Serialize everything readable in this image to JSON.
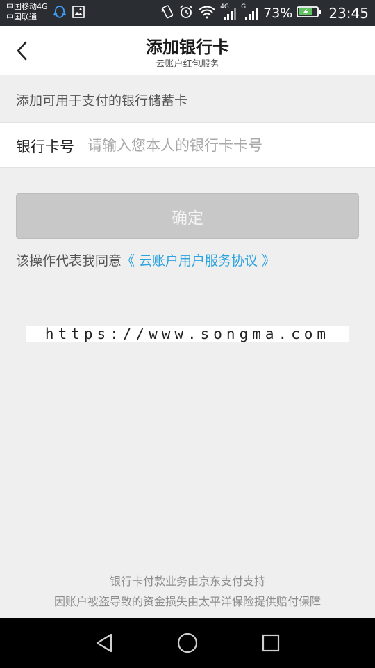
{
  "status_bar": {
    "carrier_1": "中国移动4G",
    "carrier_2": "中国联通",
    "network_1": "4G",
    "network_2": "G",
    "battery": "73%",
    "time": "23:45"
  },
  "header": {
    "title": "添加银行卡",
    "subtitle": "云账户红包服务"
  },
  "section_hint": "添加可用于支付的银行储蓄卡",
  "card_field": {
    "label": "银行卡号",
    "placeholder": "请输入您本人的银行卡卡号"
  },
  "confirm_button": {
    "label": "确定"
  },
  "agreement": {
    "prefix": "该操作代表我同意",
    "link": "《 云账户用户服务协议 》"
  },
  "watermark": "https://www.songma.com",
  "footer": {
    "line1": "银行卡付款业务由京东支付支持",
    "line2": "因账户被盗导致的资金损失由太平洋保险提供赔付保障"
  },
  "colors": {
    "accent_link": "#2aa3df",
    "button_disabled": "#c8c8c8",
    "status_bar_bg": "#2a2e33",
    "page_bg": "#efefef"
  },
  "icons": [
    "back-arrow-icon",
    "nav-back-icon",
    "nav-home-icon",
    "nav-recent-icon"
  ]
}
